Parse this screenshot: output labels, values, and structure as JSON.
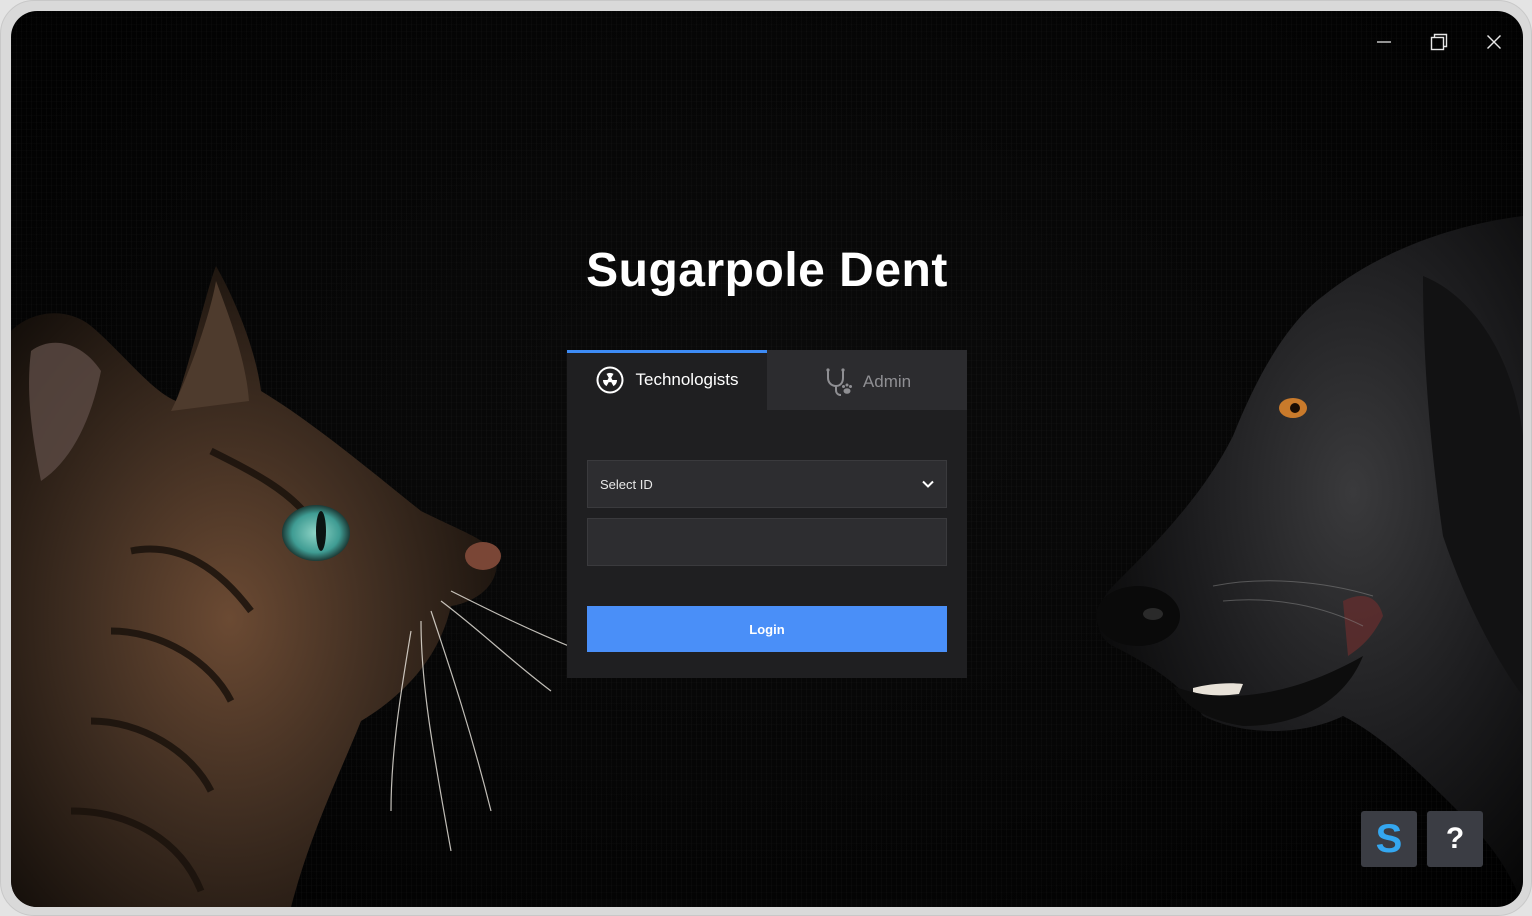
{
  "app": {
    "title": "Sugarpole Dent"
  },
  "window_controls": {
    "minimize_icon": "minimize-icon",
    "restore_icon": "restore-icon",
    "close_icon": "close-icon"
  },
  "tabs": [
    {
      "label": "Technologists",
      "icon": "radiation-icon",
      "active": true
    },
    {
      "label": "Admin",
      "icon": "stethoscope-paw-icon",
      "active": false
    }
  ],
  "form": {
    "select_id_value": "Select ID",
    "password_value": "",
    "login_label": "Login"
  },
  "corner_buttons": {
    "logo_letter": "S",
    "help_label": "?"
  },
  "colors": {
    "accent": "#4a8ff8",
    "tab_indicator": "#3d8bf5",
    "logo_blue": "#34a7f0"
  }
}
